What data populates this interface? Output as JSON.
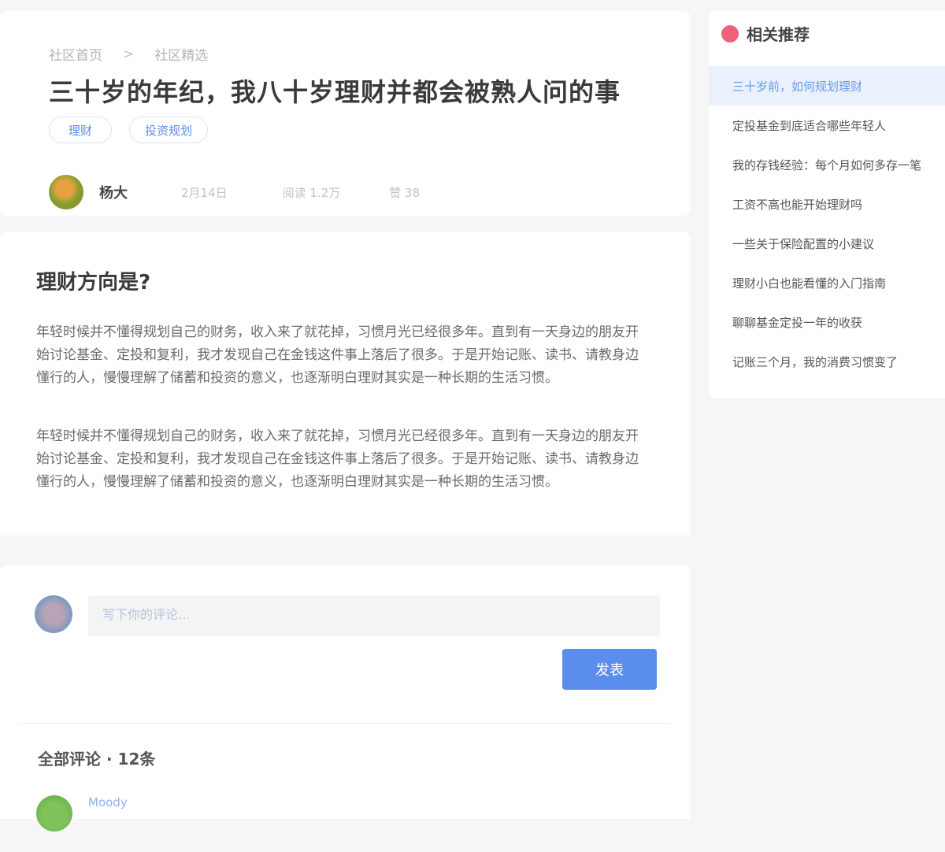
{
  "breadcrumb": {
    "parent": "社区首页",
    "separator": ">",
    "current": "社区精选"
  },
  "article": {
    "title": "三十岁的年纪，我八十岁理财并都会被熟人问的事",
    "tags": [
      "理财",
      "投资规划"
    ],
    "author": {
      "name": "杨大"
    },
    "date": "2月14日",
    "views": "阅读 1.2万",
    "likes": "赞 38"
  },
  "content": {
    "section_title": "理财方向是?",
    "paragraphs": [
      "年轻时候并不懂得规划自己的财务，收入来了就花掉，习惯月光已经很多年。直到有一天身边的朋友开始讨论基金、定投和复利，我才发现自己在金钱这件事上落后了很多。于是开始记账、读书、请教身边懂行的人，慢慢理解了储蓄和投资的意义，也逐渐明白理财其实是一种长期的生活习惯。",
      "年轻时候并不懂得规划自己的财务，收入来了就花掉，习惯月光已经很多年。直到有一天身边的朋友开始讨论基金、定投和复利，我才发现自己在金钱这件事上落后了很多。于是开始记账、读书、请教身边懂行的人，慢慢理解了储蓄和投资的意义，也逐渐明白理财其实是一种长期的生活习惯。"
    ]
  },
  "comments": {
    "input_placeholder": "写下你的评论…",
    "publish_label": "发表",
    "header": "全部评论 · 12条",
    "first_user": "Moody"
  },
  "sidebar": {
    "title": "相关推荐",
    "items": [
      "三十岁前，如何规划理财",
      "定投基金到底适合哪些年轻人",
      "我的存钱经验：每个月如何多存一笔",
      "工资不高也能开始理财吗",
      "一些关于保险配置的小建议",
      "理财小白也能看懂的入门指南",
      "聊聊基金定投一年的收获",
      "记账三个月，我的消费习惯变了"
    ],
    "active_index": 0
  }
}
